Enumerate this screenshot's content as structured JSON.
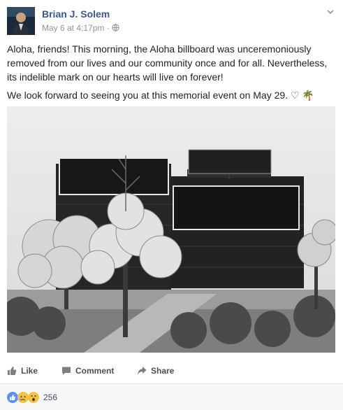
{
  "post": {
    "author": "Brian J. Solem",
    "timestamp": "May 6 at 4:17pm",
    "separator": "·",
    "paragraph1": "Aloha, friends! This morning, the Aloha billboard was unceremoniously removed from our lives and our community once and for all. Nevertheless, its indelible mark on our hearts will live on forever!",
    "paragraph2": "We look forward to seeing you at this memorial event on May 29. ♡ 🌴"
  },
  "actions": {
    "like": "Like",
    "comment": "Comment",
    "share": "Share"
  },
  "reactions": {
    "count": "256",
    "icons": [
      "like-reaction-icon",
      "sad-reaction-icon",
      "wow-reaction-icon"
    ]
  },
  "colors": {
    "author_link": "#365899",
    "meta_text": "#90949c",
    "like_blue": "#5890ff",
    "reaction_yellow": "#f5c33b"
  }
}
